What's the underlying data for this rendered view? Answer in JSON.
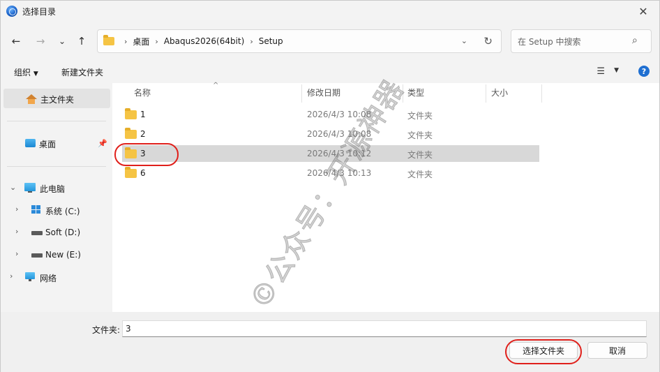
{
  "window": {
    "title": "选择目录",
    "close_symbol": "✕"
  },
  "nav": {
    "back_symbol": "←",
    "forward_symbol": "→",
    "recent_symbol": "⌄",
    "up_symbol": "↑",
    "breadcrumb": [
      "桌面",
      "Abaqus2026(64bit)",
      "Setup"
    ],
    "dropdown_symbol": "⌄",
    "refresh_symbol": "↻"
  },
  "search": {
    "placeholder": "在 Setup 中搜索"
  },
  "toolbar": {
    "organize_label": "组织",
    "new_folder_label": "新建文件夹",
    "view_symbol": "☰",
    "help_symbol": "?"
  },
  "sidebar": {
    "home_label": "主文件夹",
    "desktop_label": "桌面",
    "thispc_label": "此电脑",
    "drives": [
      "系统 (C:)",
      "Soft (D:)",
      "New (E:)"
    ],
    "network_label": "网络"
  },
  "columns": {
    "name": "名称",
    "date": "修改日期",
    "type": "类型",
    "size": "大小"
  },
  "files": [
    {
      "name": "1",
      "date": "2026/4/3 10:08",
      "type": "文件夹"
    },
    {
      "name": "2",
      "date": "2026/4/3 10:08",
      "type": "文件夹"
    },
    {
      "name": "3",
      "date": "2026/4/3 10:12",
      "type": "文件夹"
    },
    {
      "name": "6",
      "date": "2026/4/3 10:13",
      "type": "文件夹"
    }
  ],
  "footer": {
    "folder_label": "文件夹:",
    "folder_value": "3",
    "select_button": "选择文件夹",
    "cancel_button": "取消"
  },
  "watermark": "©公众号：开源神器",
  "colors": {
    "accent": "#1f6fd1",
    "annotation": "#e0201b",
    "folder": "#f5c444"
  }
}
